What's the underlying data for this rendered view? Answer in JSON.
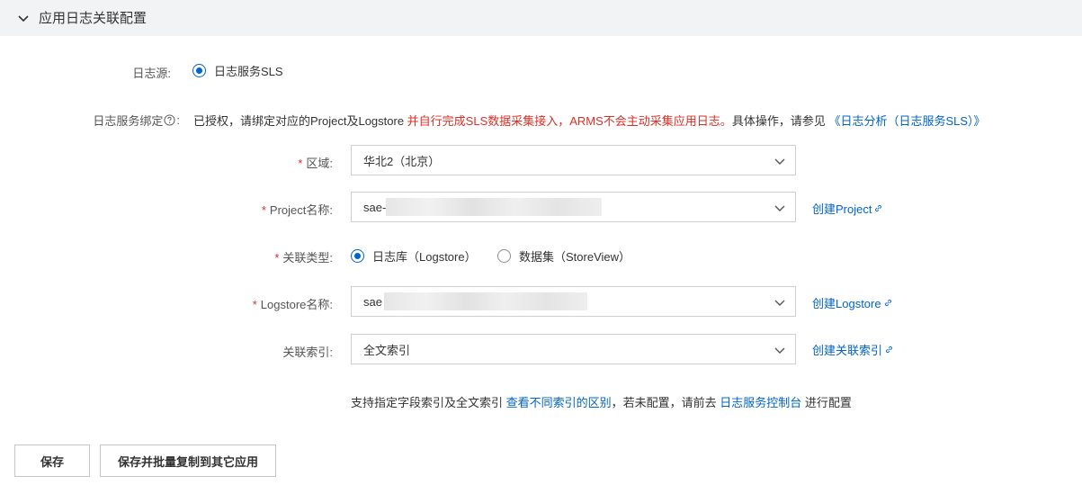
{
  "section": {
    "title": "应用日志关联配置"
  },
  "log_source": {
    "label": "日志源:",
    "option": "日志服务SLS"
  },
  "binding": {
    "label": "日志服务绑定",
    "label_suffix": ":",
    "text_prefix": "已授权，请绑定对应的Project及Logstore ",
    "text_warning": "并自行完成SLS数据采集接入，ARMS不会主动采集应用日志。",
    "text_suffix": "具体操作，请参见 ",
    "doc_link": "《日志分析（日志服务SLS）》"
  },
  "region": {
    "label": "区域:",
    "value": "华北2（北京）"
  },
  "project": {
    "label": "Project名称:",
    "value_prefix": "sae-",
    "create_link": "创建Project"
  },
  "link_type": {
    "label": "关联类型:",
    "options": [
      {
        "label": "日志库（Logstore）",
        "checked": true
      },
      {
        "label": "数据集（StoreView）",
        "checked": false
      }
    ]
  },
  "logstore": {
    "label": "Logstore名称:",
    "value_prefix": "sae",
    "create_link": "创建Logstore"
  },
  "index": {
    "label": "关联索引:",
    "value": "全文索引",
    "create_link": "创建关联索引"
  },
  "hint": {
    "text_prefix": "支持指定字段索引及全文索引 ",
    "diff_link": "查看不同索引的区别",
    "text_middle": "，若未配置，请前去 ",
    "console_link": "日志服务控制台",
    "text_suffix": " 进行配置"
  },
  "buttons": {
    "save": "保存",
    "save_copy": "保存并批量复制到其它应用"
  },
  "colors": {
    "accent": "#0064c8",
    "warning": "#d93026",
    "header_bg": "#f2f3f5"
  }
}
